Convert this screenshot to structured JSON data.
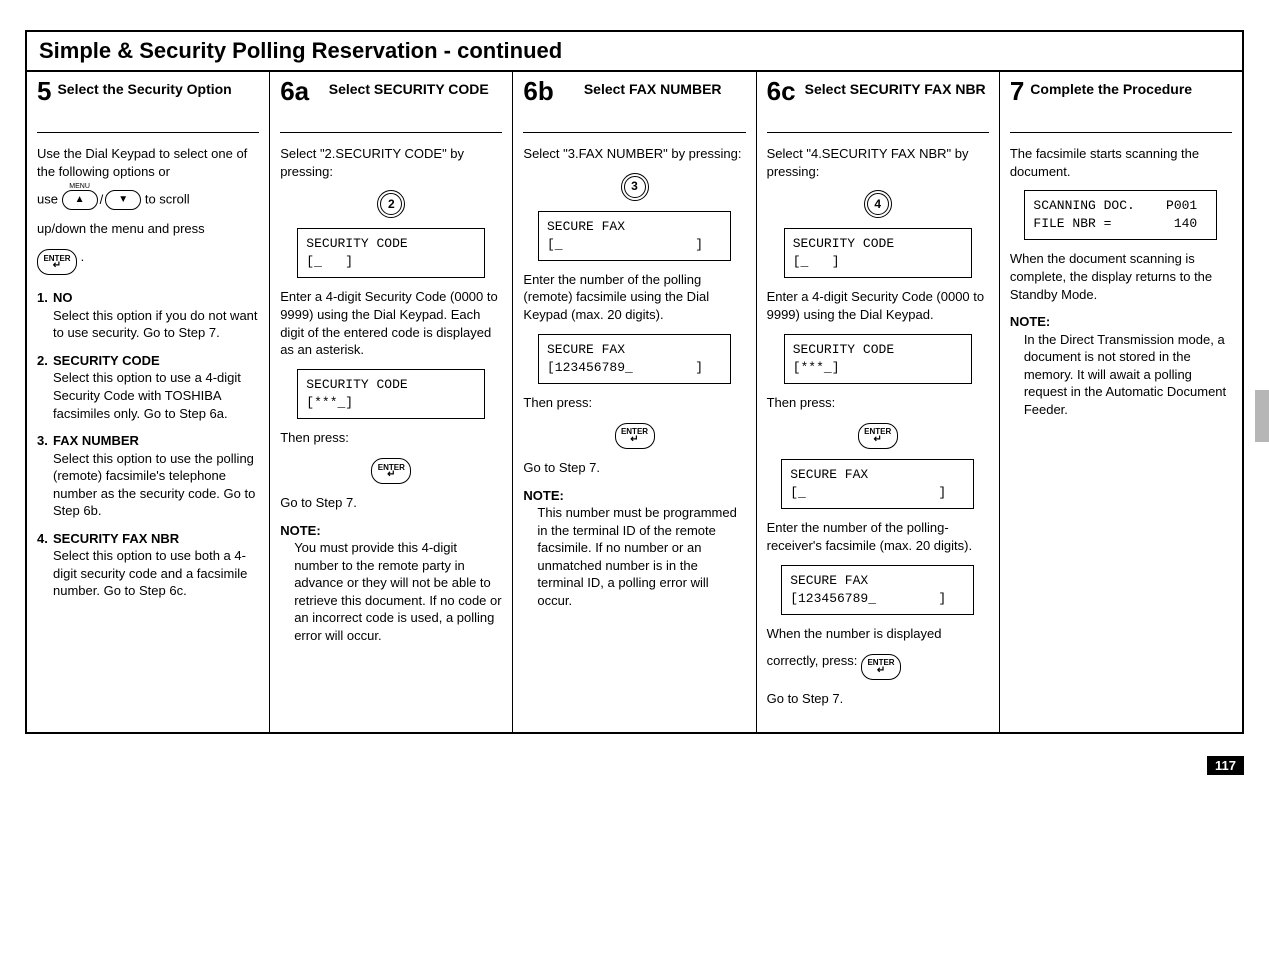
{
  "page_number": "117",
  "title": "Simple & Security Polling Reservation - continued",
  "steps": {
    "s5": {
      "num": "5",
      "title": "Select the Security Option",
      "intro_a": "Use the Dial Keypad to select one of the following options or",
      "intro_b": "use",
      "intro_c": "to scroll",
      "intro_d": "up/down the menu and press",
      "menu_label": "MENU",
      "opts": [
        {
          "n": "1.",
          "title": "NO",
          "body": "Select this option if you do not want to use security. Go to Step 7."
        },
        {
          "n": "2.",
          "title": "SECURITY CODE",
          "body": "Select this option to use a 4-digit Security Code with TOSHIBA facsimiles only. Go to Step 6a."
        },
        {
          "n": "3.",
          "title": "FAX NUMBER",
          "body": "Select this option to use the polling (remote) facsimile's telephone number as the security code. Go to Step 6b."
        },
        {
          "n": "4.",
          "title": "SECURITY FAX NBR",
          "body": "Select this option to use both a 4-digit security code and a facsimile number. Go to Step 6c."
        }
      ]
    },
    "s6a": {
      "num": "6a",
      "title": "Select SECURITY CODE",
      "line1": "Select \"2.SECURITY CODE\" by pressing:",
      "key": "2",
      "lcd1": "SECURITY CODE\n[_   ]",
      "line2": "Enter a 4-digit Security Code (0000 to 9999) using the Dial Keypad. Each digit of the entered code is displayed as an asterisk.",
      "lcd2": "SECURITY CODE\n[***_]",
      "then": "Then press:",
      "goto": "Go to Step 7.",
      "note_label": "NOTE:",
      "note": "You must provide this 4-digit number to the remote party in advance or they will not be able to retrieve this document. If no code or an incorrect code is used, a polling error will occur."
    },
    "s6b": {
      "num": "6b",
      "title": "Select FAX NUMBER",
      "line1": "Select \"3.FAX NUMBER\" by pressing:",
      "key": "3",
      "lcd1": "SECURE FAX\n[_                 ]",
      "line2": "Enter the number of the polling (remote) facsimile using the Dial Keypad (max. 20 digits).",
      "lcd2": "SECURE FAX\n[123456789_        ]",
      "then": "Then press:",
      "goto": "Go to Step 7.",
      "note_label": "NOTE:",
      "note": "This number must be programmed in the terminal ID of the remote facsimile. If no number or an unmatched number is in the terminal ID, a polling error will occur."
    },
    "s6c": {
      "num": "6c",
      "title": "Select SECURITY FAX NBR",
      "line1": "Select \"4.SECURITY FAX NBR\" by pressing:",
      "key": "4",
      "lcd1": "SECURITY CODE\n[_   ]",
      "line2": "Enter a 4-digit Security Code (0000 to 9999) using the Dial Keypad.",
      "lcd2": "SECURITY CODE\n[***_]",
      "then": "Then press:",
      "lcd3": "SECURE FAX\n[_                 ]",
      "line3": "Enter the number of the polling-receiver's facsimile (max. 20 digits).",
      "lcd4": "SECURE FAX\n[123456789_        ]",
      "line4a": "When the number is displayed",
      "line4b": "correctly, press:",
      "goto": "Go to Step 7."
    },
    "s7": {
      "num": "7",
      "title": "Complete the Procedure",
      "line1": "The facsimile starts scanning the document.",
      "lcd1": "SCANNING DOC.    P001\nFILE NBR =        140",
      "line2": "When the document scanning is complete, the display returns to the Standby Mode.",
      "note_label": "NOTE:",
      "note": "In the Direct Transmission mode, a document is not stored in the memory. It will await a polling request in the Automatic Document Feeder."
    }
  },
  "enter_label": "ENTER"
}
